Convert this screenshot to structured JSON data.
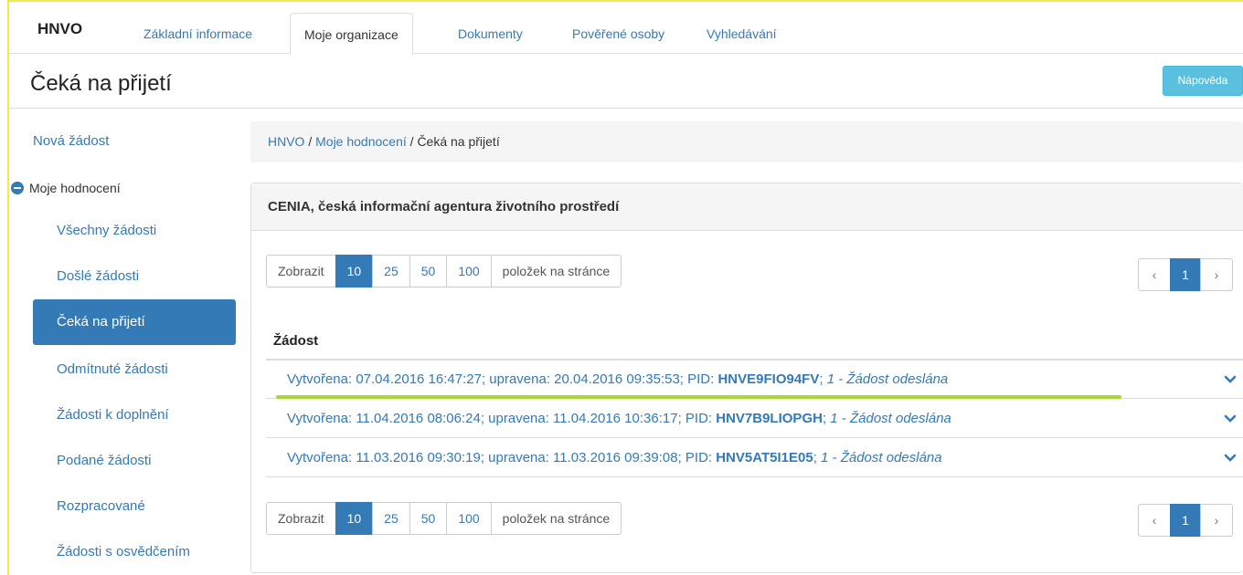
{
  "nav": {
    "brand": "HNVO",
    "tabs": [
      {
        "label": "Základní informace"
      },
      {
        "label": "Moje organizace"
      },
      {
        "label": "Dokumenty"
      },
      {
        "label": "Pověřené osoby"
      },
      {
        "label": "Vyhledávání"
      }
    ],
    "active_tab": "Moje organizace"
  },
  "header": {
    "title": "Čeká na přijetí",
    "help_label": "Nápověda"
  },
  "sidebar": {
    "new_request": "Nová žádost",
    "group_label": "Moje hodnocení",
    "items": [
      {
        "label": "Všechny žádosti"
      },
      {
        "label": "Došlé žádosti"
      },
      {
        "label": "Čeká na přijetí"
      },
      {
        "label": "Odmítnuté žádosti"
      },
      {
        "label": "Žádosti k doplnění"
      },
      {
        "label": "Podané žádosti"
      },
      {
        "label": "Rozpracované"
      },
      {
        "label": "Žádosti s osvědčením"
      }
    ],
    "active_item": "Čeká na přijetí"
  },
  "breadcrumb": {
    "root": "HNVO",
    "sep": " / ",
    "middle": "Moje hodnocení",
    "current": "Čeká na přijetí"
  },
  "panel": {
    "title": "CENIA, česká informační agentura životního prostředí",
    "column_header": "Žádost"
  },
  "pagination": {
    "show_label": "Zobrazit",
    "sizes": [
      "10",
      "25",
      "50",
      "100"
    ],
    "selected_size": "10",
    "suffix": "položek na stránce",
    "prev": "‹",
    "current_page": "1",
    "next": "›"
  },
  "rows": [
    {
      "prefix": "Vytvořena: 07.04.2016 16:47:27; upravena: 20.04.2016 09:35:53; PID: ",
      "pid": "HNVE9FIO94FV",
      "sep": "; ",
      "status": "1 - Žádost odeslána"
    },
    {
      "prefix": "Vytvořena: 11.04.2016 08:06:24; upravena: 11.04.2016 10:36:17; PID: ",
      "pid": "HNV7B9LIOPGH",
      "sep": "; ",
      "status": "1 - Žádost odeslána"
    },
    {
      "prefix": "Vytvořena: 11.03.2016 09:30:19; upravena: 11.03.2016 09:39:08; PID: ",
      "pid": "HNV5AT5I1E05",
      "sep": "; ",
      "status": "1 - Žádost odeslána"
    }
  ],
  "colors": {
    "accent": "#337ab7",
    "help": "#5bc0de",
    "highlight": "#a8d836",
    "frame": "#f5e84a"
  },
  "icons": {
    "row_expand": "chevron-down-icon",
    "group": "minus-circle-icon"
  }
}
